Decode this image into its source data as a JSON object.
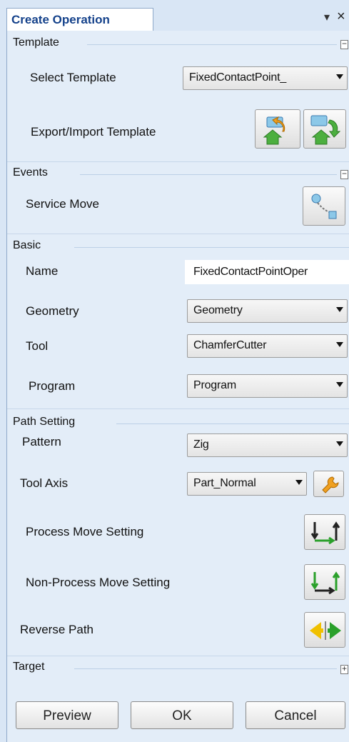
{
  "window": {
    "title": "Create Operation",
    "pin_glyph": "▾",
    "close_glyph": "×"
  },
  "sections": {
    "template": {
      "title": "Template",
      "toggle": "−"
    },
    "events": {
      "title": "Events",
      "toggle": "−"
    },
    "basic": {
      "title": "Basic"
    },
    "path_setting": {
      "title": "Path Setting"
    },
    "target": {
      "title": "Target",
      "toggle": "+"
    }
  },
  "template": {
    "select_label": "Select Template",
    "select_value": "FixedContactPoint_",
    "export_import_label": "Export/Import Template",
    "export_icon": "export-template-icon",
    "import_icon": "import-template-icon"
  },
  "events": {
    "service_move_label": "Service Move",
    "service_move_icon": "service-move-icon"
  },
  "basic": {
    "name_label": "Name",
    "name_value": "FixedContactPointOper",
    "geometry_label": "Geometry",
    "geometry_value": "Geometry",
    "tool_label": "Tool",
    "tool_value": "ChamferCutter",
    "program_label": "Program",
    "program_value": "Program"
  },
  "path_setting": {
    "pattern_label": "Pattern",
    "pattern_value": "Zig",
    "tool_axis_label": "Tool Axis",
    "tool_axis_value": "Part_Normal",
    "tool_axis_icon": "wrench-icon",
    "process_move_label": "Process Move Setting",
    "non_process_move_label": "Non-Process Move Setting",
    "reverse_path_label": "Reverse Path"
  },
  "buttons": {
    "preview": "Preview",
    "ok": "OK",
    "cancel": "Cancel"
  },
  "colors": {
    "panel_background": "#e3edf8",
    "title_text": "#15428b",
    "green_arrow": "#2aa02a",
    "yellow_arrow": "#f0c000"
  }
}
